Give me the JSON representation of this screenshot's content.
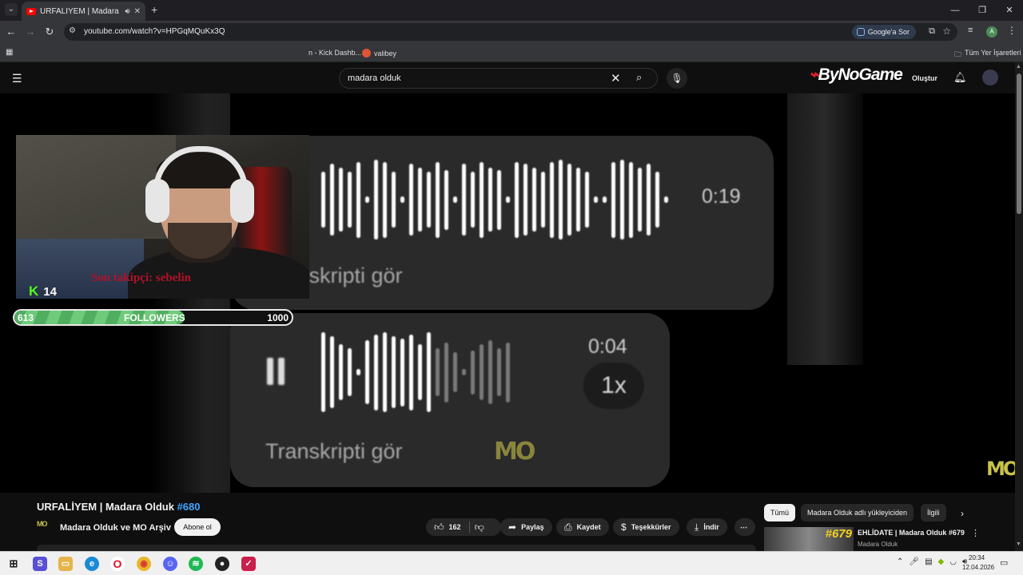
{
  "browser": {
    "tab_title": "URFALİYEM | Madara Olduk",
    "url": "youtube.com/watch?v=HPGqMQuKx3Q",
    "google_ask": "Google'a Sor",
    "bookmarks": {
      "kick": "n - Kick Dashb...",
      "valibey": "valibey",
      "all": "Tüm Yer İşaretleri"
    }
  },
  "youtube": {
    "search_value": "madara olduk",
    "logo_text": "ByNoGame",
    "create_label": "Oluştur"
  },
  "video": {
    "top_cut_text": "",
    "voice_message_1": {
      "duration": "0:19",
      "transcript": "Transkripti gör"
    },
    "voice_message_2": {
      "duration": "0:04",
      "transcript": "Transkripti gör",
      "speed": "1x"
    },
    "watermark": "MO",
    "overlay": {
      "last_follower": "Son takipçi: sebelin",
      "kick_count": "14",
      "followers_current": "613",
      "followers_label": "FOLLOWERS",
      "followers_goal": "1000",
      "progress_fraction": 0.613
    }
  },
  "info": {
    "title": "URFALİYEM | Madara Olduk",
    "hashtag": "#680",
    "channel_avatar": "MO",
    "channel_name": "Madara Olduk ve MO Arşiv",
    "subscribe": "Abone ol",
    "likes": "162",
    "share": "Paylaş",
    "save": "Kaydet",
    "thanks": "Teşekkürler",
    "download": "İndir",
    "more": "⋯"
  },
  "sidebar": {
    "chips": [
      "Tümü",
      "Madara Olduk adlı yükleyiciden",
      "İlgili"
    ],
    "recommendation": {
      "thumb_number": "#679",
      "title": "EHLİDATE | Madara Olduk #679",
      "channel": "Madara Olduk"
    }
  },
  "taskbar": {
    "time": "20:34",
    "date": "12.04.2026"
  },
  "colors": {
    "accent_red": "#ff0000",
    "kick_green": "#53fc18",
    "link_blue": "#3ea6ff",
    "progress_green": "#4fae5f"
  }
}
